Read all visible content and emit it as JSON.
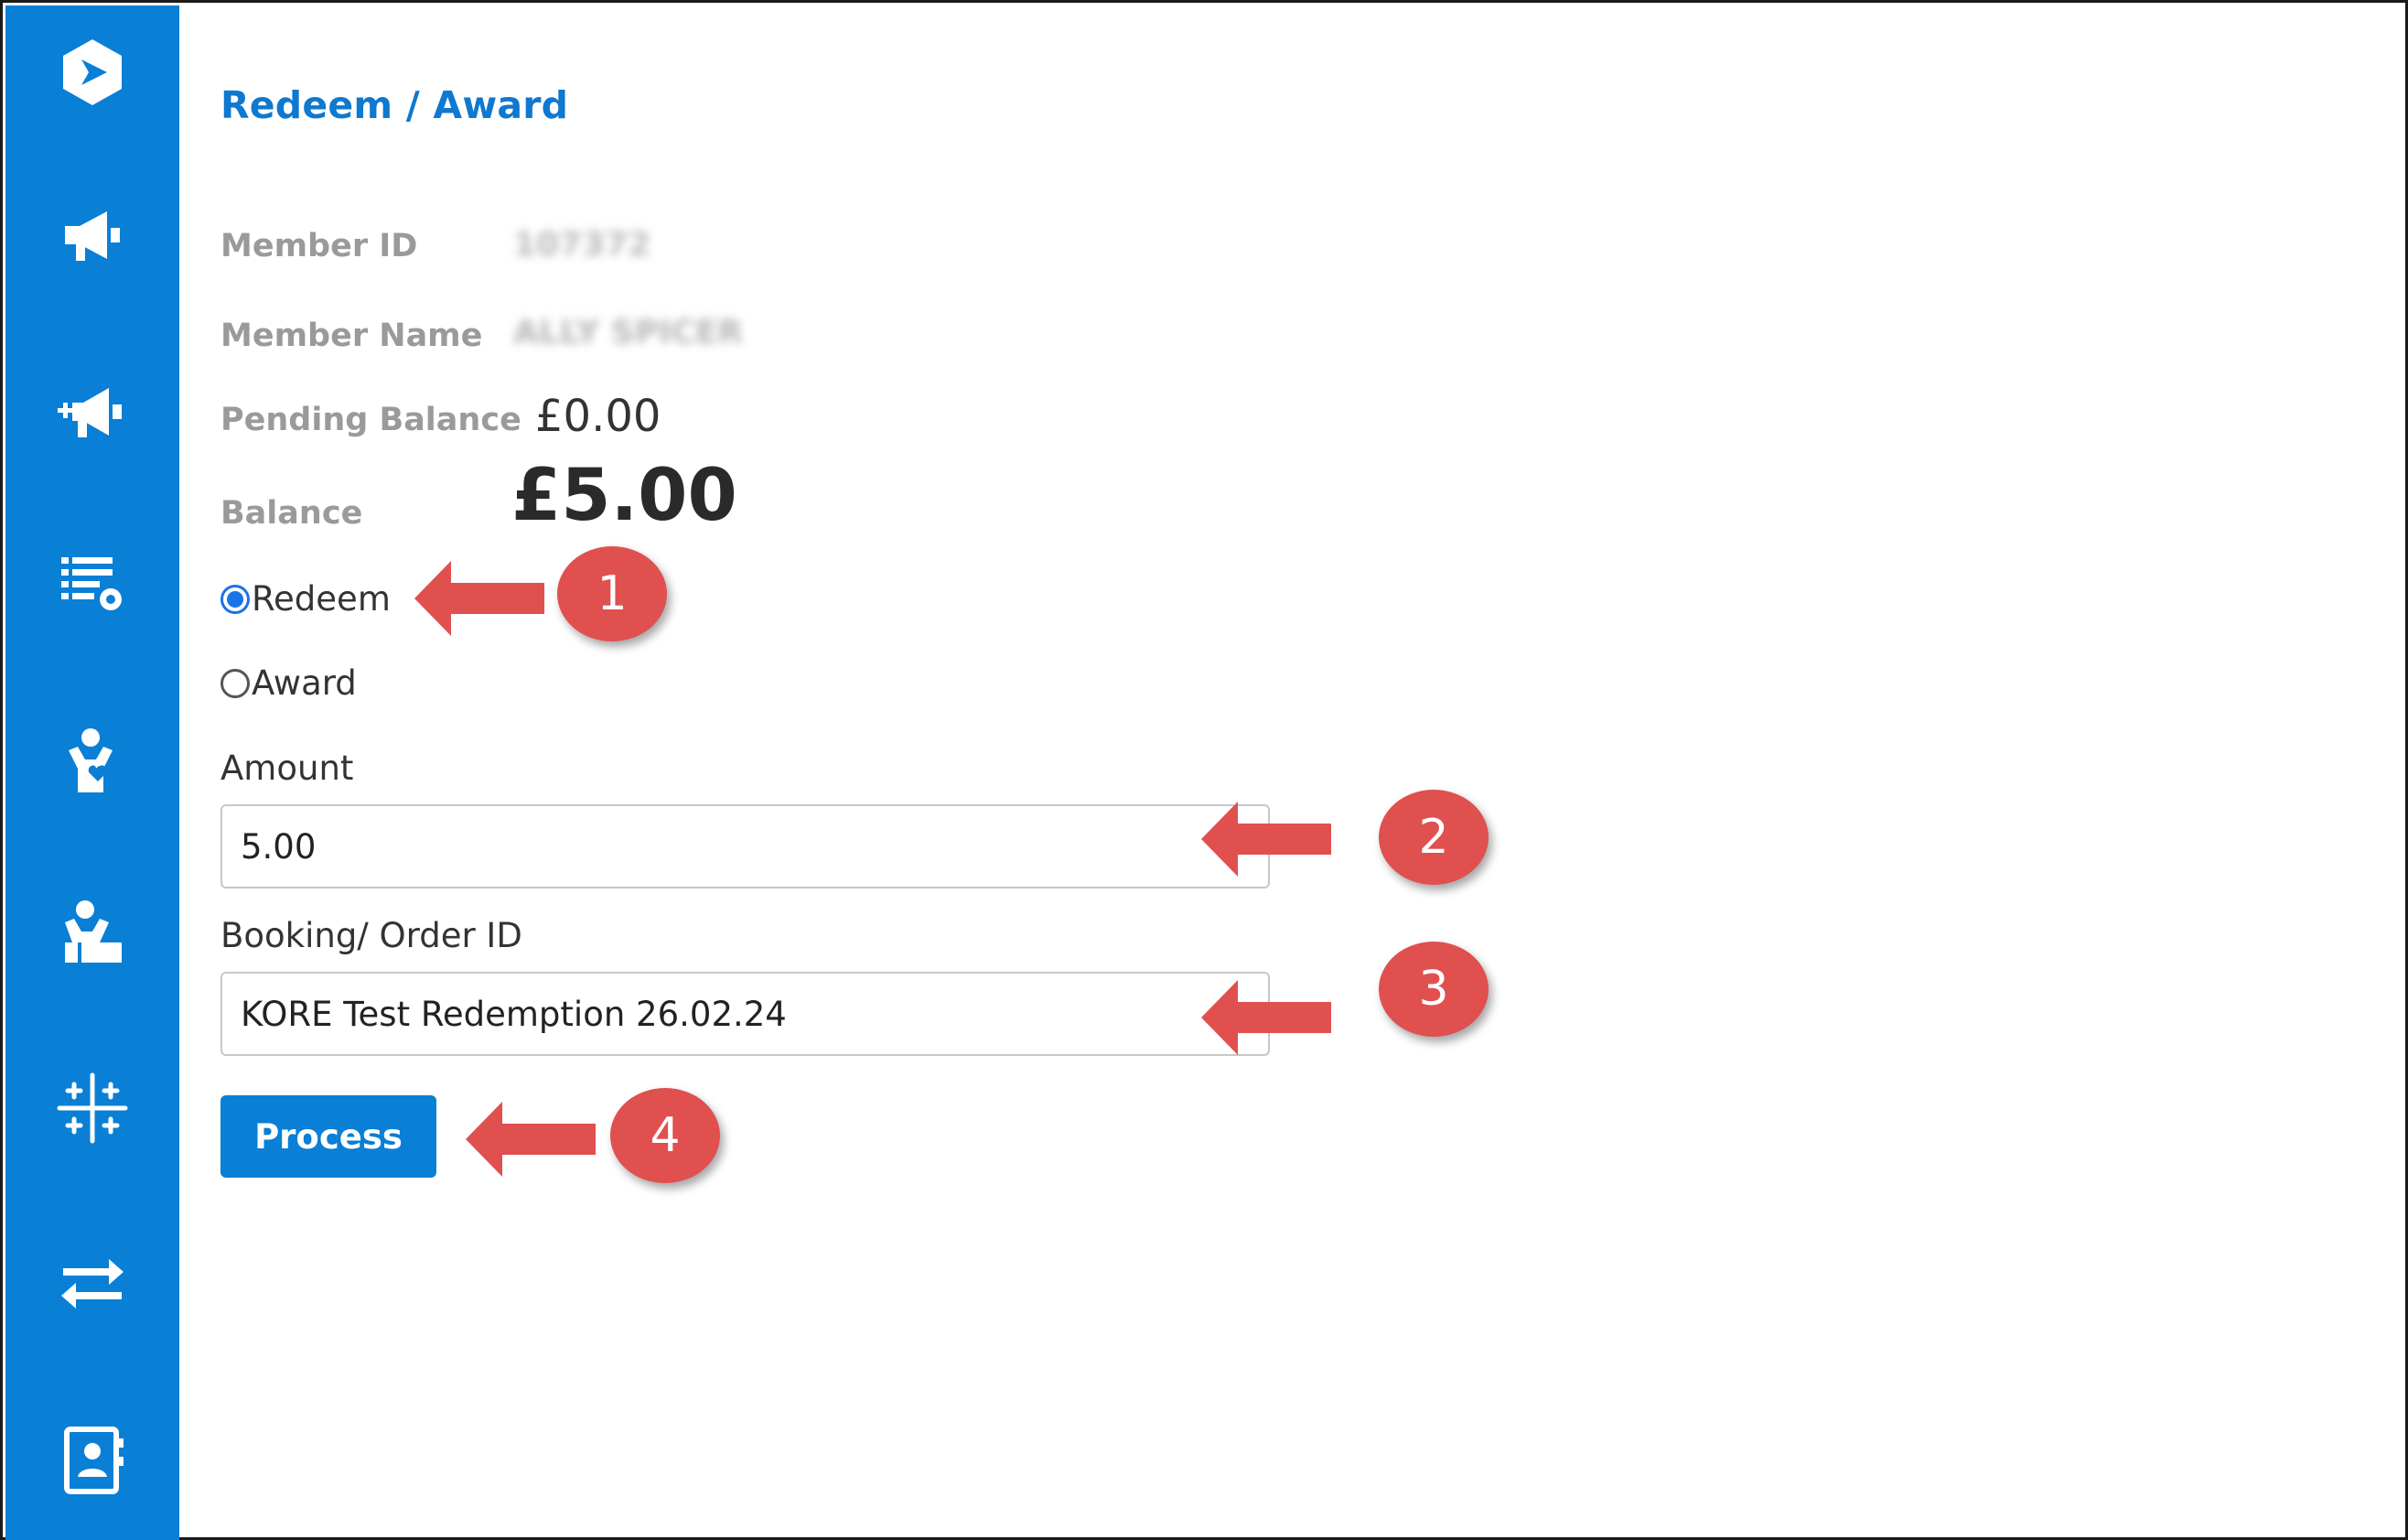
{
  "page": {
    "title": "Redeem / Award"
  },
  "member": {
    "id_label": "Member ID",
    "id_value": "107372",
    "name_label": "Member Name",
    "name_value": "ALLY SPICER",
    "pending_label": "Pending Balance",
    "pending_value": "£0.00",
    "balance_label": "Balance",
    "balance_value": "£5.00"
  },
  "options": {
    "redeem_label": "Redeem",
    "award_label": "Award",
    "selected": "Redeem"
  },
  "form": {
    "amount_label": "Amount",
    "amount_value": "5.00",
    "order_label": "Booking/ Order ID",
    "order_value": "KORE Test Redemption 26.02.24",
    "process_label": "Process"
  },
  "annotations": {
    "a1": "1",
    "a2": "2",
    "a3": "3",
    "a4": "4",
    "color": "#e0504f"
  },
  "sidebar": {
    "icons": [
      "logo-icon",
      "megaphone-icon",
      "megaphone-plus-icon",
      "list-settings-icon",
      "person-heart-icon",
      "person-desk-icon",
      "sparkle-grid-icon",
      "transfer-arrows-icon",
      "contact-book-icon"
    ],
    "color": "#0a7fd6"
  }
}
